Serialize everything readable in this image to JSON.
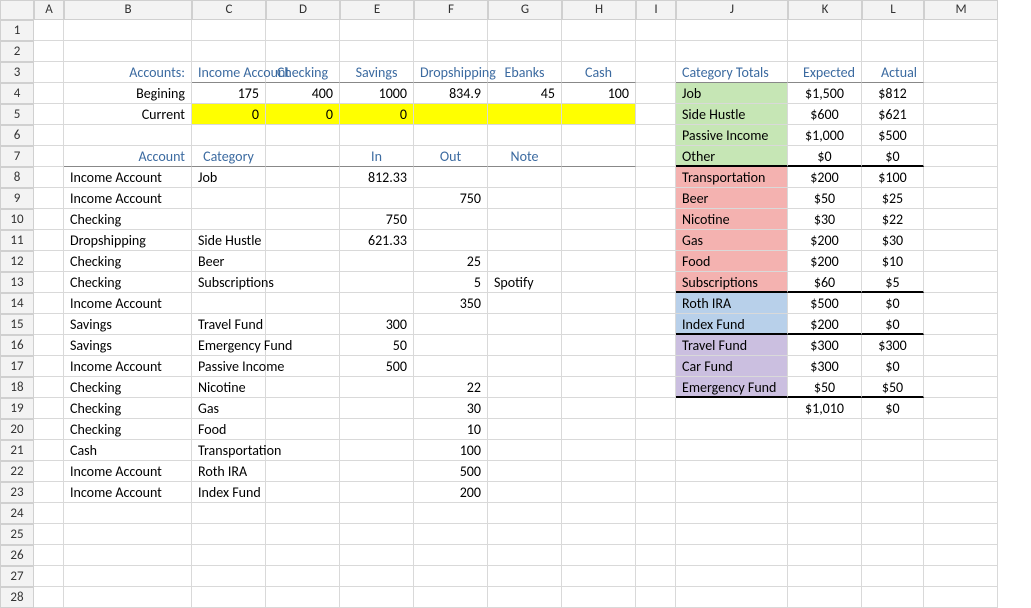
{
  "columns": [
    "A",
    "B",
    "C",
    "D",
    "E",
    "F",
    "G",
    "H",
    "I",
    "J",
    "K",
    "L",
    "M"
  ],
  "rowCount": 28,
  "accountsHeader": {
    "label": "Accounts:",
    "names": [
      "Income Account",
      "Checking",
      "Savings",
      "Dropshipping",
      "Ebanks",
      "Cash"
    ]
  },
  "beginning": {
    "label": "Begining",
    "values": [
      "175",
      "400",
      "1000",
      "834.9",
      "45",
      "100"
    ]
  },
  "current": {
    "label": "Current",
    "values": [
      "0",
      "0",
      "0",
      "",
      "",
      ""
    ]
  },
  "transHeader": {
    "account": "Account",
    "category": "Category",
    "in": "In",
    "out": "Out",
    "note": "Note"
  },
  "transactions": [
    {
      "account": "Income Account",
      "category": "Job",
      "in": "812.33",
      "out": "",
      "note": ""
    },
    {
      "account": "Income Account",
      "category": "",
      "in": "",
      "out": "750",
      "note": ""
    },
    {
      "account": "Checking",
      "category": "",
      "in": "750",
      "out": "",
      "note": ""
    },
    {
      "account": "Dropshipping",
      "category": "Side Hustle",
      "in": "621.33",
      "out": "",
      "note": ""
    },
    {
      "account": "Checking",
      "category": "Beer",
      "in": "",
      "out": "25",
      "note": ""
    },
    {
      "account": "Checking",
      "category": "Subscriptions",
      "in": "",
      "out": "5",
      "note": "Spotify"
    },
    {
      "account": "Income Account",
      "category": "",
      "in": "",
      "out": "350",
      "note": ""
    },
    {
      "account": "Savings",
      "category": "Travel Fund",
      "in": "300",
      "out": "",
      "note": ""
    },
    {
      "account": "Savings",
      "category": "Emergency Fund",
      "in": "50",
      "out": "",
      "note": ""
    },
    {
      "account": "Income Account",
      "category": "Passive Income",
      "in": "500",
      "out": "",
      "note": ""
    },
    {
      "account": "Checking",
      "category": "Nicotine",
      "in": "",
      "out": "22",
      "note": ""
    },
    {
      "account": "Checking",
      "category": "Gas",
      "in": "",
      "out": "30",
      "note": ""
    },
    {
      "account": "Checking",
      "category": "Food",
      "in": "",
      "out": "10",
      "note": ""
    },
    {
      "account": "Cash",
      "category": "Transportation",
      "in": "",
      "out": "100",
      "note": ""
    },
    {
      "account": "Income Account",
      "category": "Roth IRA",
      "in": "",
      "out": "500",
      "note": ""
    },
    {
      "account": "Income Account",
      "category": "Index Fund",
      "in": "",
      "out": "200",
      "note": ""
    }
  ],
  "categoryTotals": {
    "header": {
      "title": "Category Totals",
      "expected": "Expected",
      "actual": "Actual"
    },
    "groups": [
      {
        "color": "green",
        "rows": [
          {
            "name": "Job",
            "expected": "$1,500",
            "actual": "$812"
          },
          {
            "name": "Side Hustle",
            "expected": "$600",
            "actual": "$621"
          },
          {
            "name": "Passive Income",
            "expected": "$1,000",
            "actual": "$500"
          },
          {
            "name": "Other",
            "expected": "$0",
            "actual": "$0"
          }
        ]
      },
      {
        "color": "red",
        "rows": [
          {
            "name": "Transportation",
            "expected": "$200",
            "actual": "$100"
          },
          {
            "name": "Beer",
            "expected": "$50",
            "actual": "$25"
          },
          {
            "name": "Nicotine",
            "expected": "$30",
            "actual": "$22"
          },
          {
            "name": "Gas",
            "expected": "$200",
            "actual": "$30"
          },
          {
            "name": "Food",
            "expected": "$200",
            "actual": "$10"
          },
          {
            "name": "Subscriptions",
            "expected": "$60",
            "actual": "$5"
          }
        ]
      },
      {
        "color": "blue",
        "rows": [
          {
            "name": "Roth IRA",
            "expected": "$500",
            "actual": "$0"
          },
          {
            "name": "Index Fund",
            "expected": "$200",
            "actual": "$0"
          }
        ]
      },
      {
        "color": "purple",
        "rows": [
          {
            "name": "Travel Fund",
            "expected": "$300",
            "actual": "$300"
          },
          {
            "name": "Car Fund",
            "expected": "$300",
            "actual": "$0"
          },
          {
            "name": "Emergency Fund",
            "expected": "$50",
            "actual": "$50"
          }
        ]
      }
    ],
    "footer": {
      "expected": "$1,010",
      "actual": "$0"
    }
  }
}
